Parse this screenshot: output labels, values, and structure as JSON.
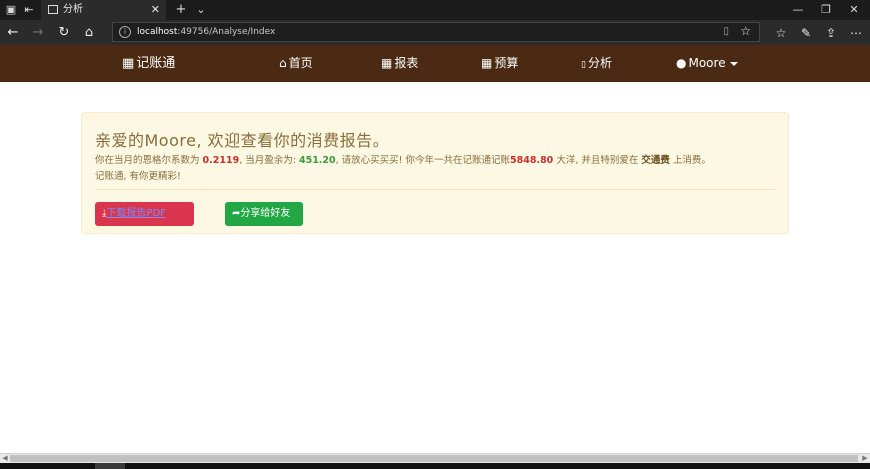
{
  "browser": {
    "tab_title": "分析",
    "tab_close": "✕",
    "new_tab": "+",
    "tab_list": "⌄",
    "url_host": "localhost",
    "url_rest": ":49756/Analyse/Index",
    "win_minimize": "—",
    "win_maximize": "❐",
    "win_close": "✕"
  },
  "navbar": {
    "brand": "记账通",
    "items": [
      {
        "label": "首页",
        "icon": "home-icon"
      },
      {
        "label": "报表",
        "icon": "table-icon"
      },
      {
        "label": "预算",
        "icon": "calendar-icon"
      },
      {
        "label": "分析",
        "icon": "chart-icon"
      }
    ],
    "user": "Moore"
  },
  "report": {
    "heading": "亲爱的Moore, 欢迎查看你的消费报告。",
    "t1": "你在当月的恩格尔系数为 ",
    "engel": "0.2119",
    "t2": ", 当月盈余为: ",
    "surplus": "451.20",
    "t3": ", 请放心买买买! 你今年一共在记账通记账",
    "total": "5848.80",
    "t4": " 大洋, 并且特别爱在 ",
    "category": "交通费",
    "t5": " 上消费。",
    "line2": "记账通, 有你更精彩!"
  },
  "buttons": {
    "download_label": "下载报告PDF",
    "share_label": "分享给好友"
  },
  "colors": {
    "navbar_bg": "#4a2a12",
    "alert_bg": "#fcf8e3",
    "alert_text": "#8a6d3b",
    "danger": "#d9364d",
    "success": "#21a744"
  }
}
